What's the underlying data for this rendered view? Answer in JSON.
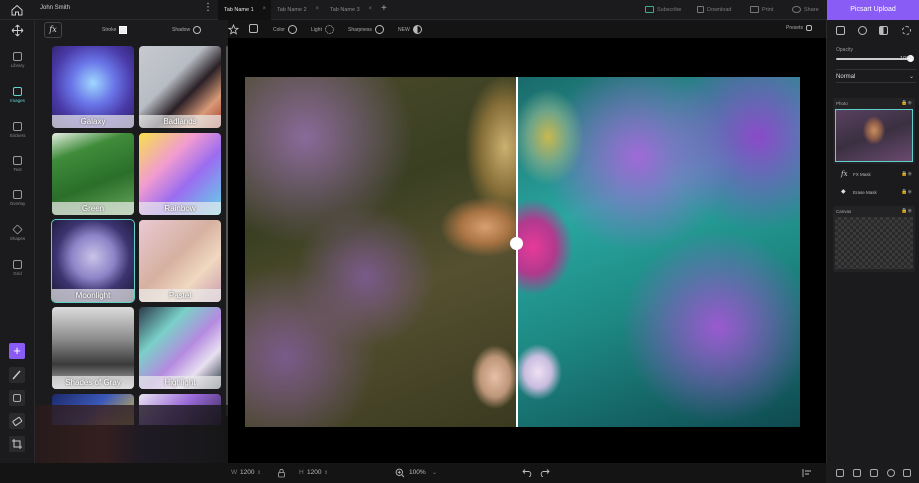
{
  "topbar": {
    "user": "John Smith",
    "more": "⋮",
    "tabs": [
      {
        "label": "Tab Name 1",
        "active": true
      },
      {
        "label": "Tab Name 2",
        "active": false
      },
      {
        "label": "Tab Name 3",
        "active": false
      }
    ],
    "close": "×",
    "add": "+",
    "actions": [
      "Subscribe",
      "Download",
      "Print",
      "Share"
    ],
    "upload": "Picsart Upload"
  },
  "rail": {
    "items": [
      {
        "label": "Library",
        "icon": "folder-icon"
      },
      {
        "label": "Images",
        "icon": "image-icon",
        "active": true
      },
      {
        "label": "Stickers",
        "icon": "sticker-icon"
      },
      {
        "label": "Text",
        "icon": "text-icon"
      },
      {
        "label": "Overlay",
        "icon": "overlay-icon"
      },
      {
        "label": "Shapes",
        "icon": "shapes-icon"
      },
      {
        "label": "Grid",
        "icon": "grid-icon"
      }
    ],
    "add": "+"
  },
  "effects_panel": {
    "fx": "fx",
    "stroke_label": "Stroke",
    "shadow_label": "Shadow",
    "tiles": [
      {
        "label": "Galaxy"
      },
      {
        "label": "Badlands"
      },
      {
        "label": "Green"
      },
      {
        "label": "Rainbow"
      },
      {
        "label": "Moonlight",
        "selected": true
      },
      {
        "label": "Pastel"
      },
      {
        "label": "Shades of Gray"
      },
      {
        "label": "Highlight"
      },
      {
        "label": ""
      },
      {
        "label": ""
      }
    ]
  },
  "canvas_toolbar": {
    "color": "Color",
    "light": "Light",
    "sharpness": "Sharpness",
    "new": "NEW",
    "presets": "Presets"
  },
  "bottombar": {
    "w_label": "W",
    "w_value": "1200",
    "h_label": "H",
    "h_value": "1200",
    "zoom": "100%"
  },
  "right_panel": {
    "opacity_label": "Opacity",
    "opacity_value": "100%",
    "opacity": 1.0,
    "blend_mode": "Normal",
    "photo_layer": "Photo",
    "fx_mask": "FX Mask",
    "erase_mask": "Erase Mask",
    "canvas_layer": "Canvas"
  },
  "colors": {
    "accent": "#8a5cf6",
    "selection": "#5fd1cb"
  }
}
